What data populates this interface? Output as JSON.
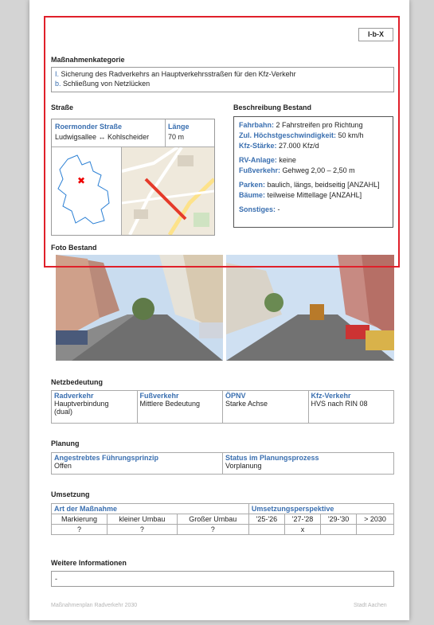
{
  "id_badge": "I-b-X",
  "kategorie": {
    "heading": "Maßnahmenkategorie",
    "lines": [
      {
        "key": "I.",
        "text": "Sicherung des Radverkehrs an Hauptverkehrsstraßen für den Kfz-Verkehr"
      },
      {
        "key": "b.",
        "text": "Schließung von Netzlücken"
      }
    ]
  },
  "strasse": {
    "heading": "Straße",
    "name": "Roermonder Straße",
    "route": "Ludwigsallee ↔ Kohlscheider",
    "laenge_label": "Länge",
    "laenge_value": "70 m"
  },
  "bestand": {
    "heading": "Beschreibung Bestand",
    "items": [
      {
        "label": "Fahrbahn:",
        "value": "2 Fahrstreifen pro Richtung"
      },
      {
        "label": "Zul. Höchstgeschwindigkeit:",
        "value": "50 km/h"
      },
      {
        "label": "Kfz-Stärke:",
        "value": "27.000 Kfz/d"
      },
      {
        "label": "RV-Anlage:",
        "value": "keine"
      },
      {
        "label": "Fußverkehr:",
        "value": "Gehweg 2,00 – 2,50 m"
      },
      {
        "label": "Parken:",
        "value": "baulich, längs, beidseitig [ANZAHL]"
      },
      {
        "label": "Bäume:",
        "value": "teilweise Mittellage [ANZAHL]"
      },
      {
        "label": "Sonstiges:",
        "value": "-"
      }
    ]
  },
  "foto": {
    "heading": "Foto Bestand"
  },
  "netz": {
    "heading": "Netzbedeutung",
    "cols": [
      {
        "label": "Radverkehr",
        "value": "Hauptverbindung (dual)"
      },
      {
        "label": "Fußverkehr",
        "value": "Mittlere Bedeutung"
      },
      {
        "label": "ÖPNV",
        "value": "Starke Achse"
      },
      {
        "label": "Kfz-Verkehr",
        "value": "HVS nach RIN 08"
      }
    ]
  },
  "planung": {
    "heading": "Planung",
    "cols": [
      {
        "label": "Angestrebtes Führungsprinzip",
        "value": "Offen"
      },
      {
        "label": "Status im Planungsprozess",
        "value": "Vorplanung"
      }
    ]
  },
  "umsetzung": {
    "heading": "Umsetzung",
    "art_label": "Art der Maßnahme",
    "persp_label": "Umsetzungsperspektive",
    "art_cols": [
      "Markierung",
      "kleiner Umbau",
      "Großer Umbau"
    ],
    "art_vals": [
      "?",
      "?",
      "?"
    ],
    "persp_cols": [
      "'25-'26",
      "'27-'28",
      "'29-'30",
      "> 2030"
    ],
    "persp_vals": [
      "",
      "x",
      "",
      ""
    ]
  },
  "weitere": {
    "heading": "Weitere Informationen",
    "value": "-"
  },
  "footer": {
    "left": "Maßnahmenplan Radverkehr 2030",
    "right": "Stadt Aachen"
  }
}
